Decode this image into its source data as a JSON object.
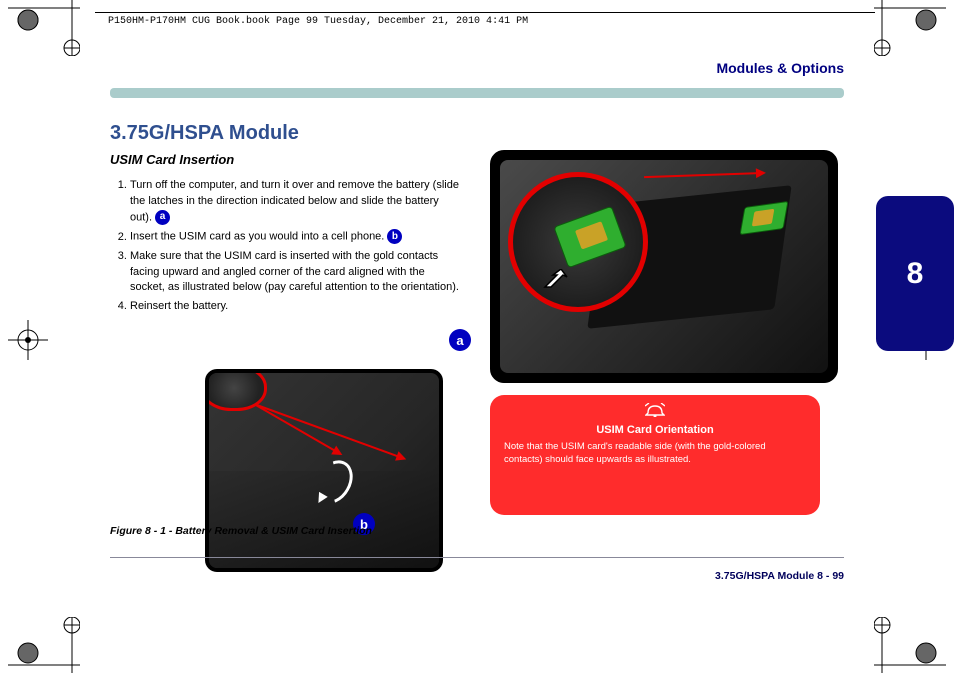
{
  "meta": {
    "book_line": "P150HM-P170HM CUG Book.book  Page 99  Tuesday, December 21, 2010  4:41 PM"
  },
  "chapter": {
    "top_label": "Modules & Options",
    "side_number": "8"
  },
  "section": {
    "title": "3.75G/HSPA Module",
    "subtitle": "USIM Card Insertion"
  },
  "steps": {
    "items": [
      "Turn off the computer, and turn it over and remove the battery (slide the latches in the direction indicated below and slide the battery out).",
      "Insert the USIM card as you would into a cell phone.",
      "Make sure that the USIM card is inserted with the gold contacts facing upward and angled corner of the card aligned with the socket, as illustrated below (pay careful attention to the orientation).",
      "Reinsert the battery."
    ],
    "inline_ref_a": "a",
    "inline_ref_b": "b"
  },
  "big_steps": {
    "a": "a",
    "b": "b"
  },
  "caution": {
    "title": "USIM Card Orientation",
    "body": "Note that the USIM card's readable side (with the gold-colored contacts) should face upwards as illustrated."
  },
  "figure_caption": "Figure 8 - 1 - Battery Removal & USIM Card Insertion",
  "footer": "3.75G/HSPA Module  8 - 99"
}
